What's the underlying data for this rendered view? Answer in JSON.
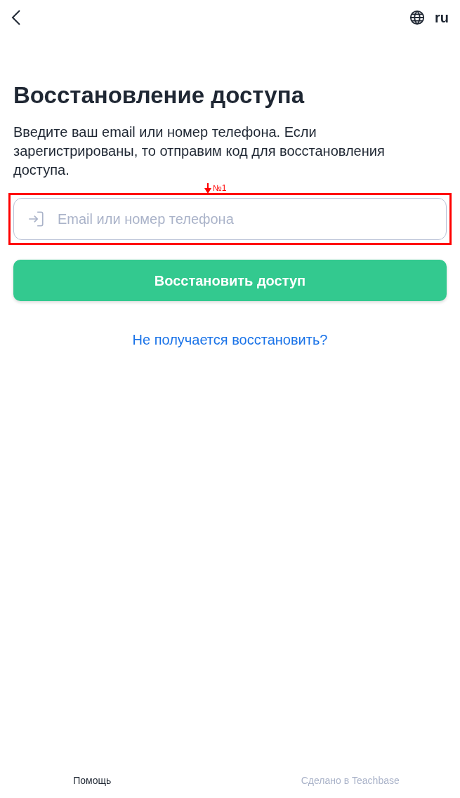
{
  "header": {
    "language": "ru"
  },
  "title": "Восстановление доступа",
  "description": "Введите ваш email или номер телефона. Если зарегистрированы, то отправим код для восстановления доступа.",
  "login_field": {
    "placeholder": "Email или номер телефона"
  },
  "annotation": {
    "label": "№1"
  },
  "submit_button": "Восстановить доступ",
  "help_link": "Не получается восстановить?",
  "footer": {
    "help": "Помощь",
    "credit": "Сделано в Teachbase"
  }
}
